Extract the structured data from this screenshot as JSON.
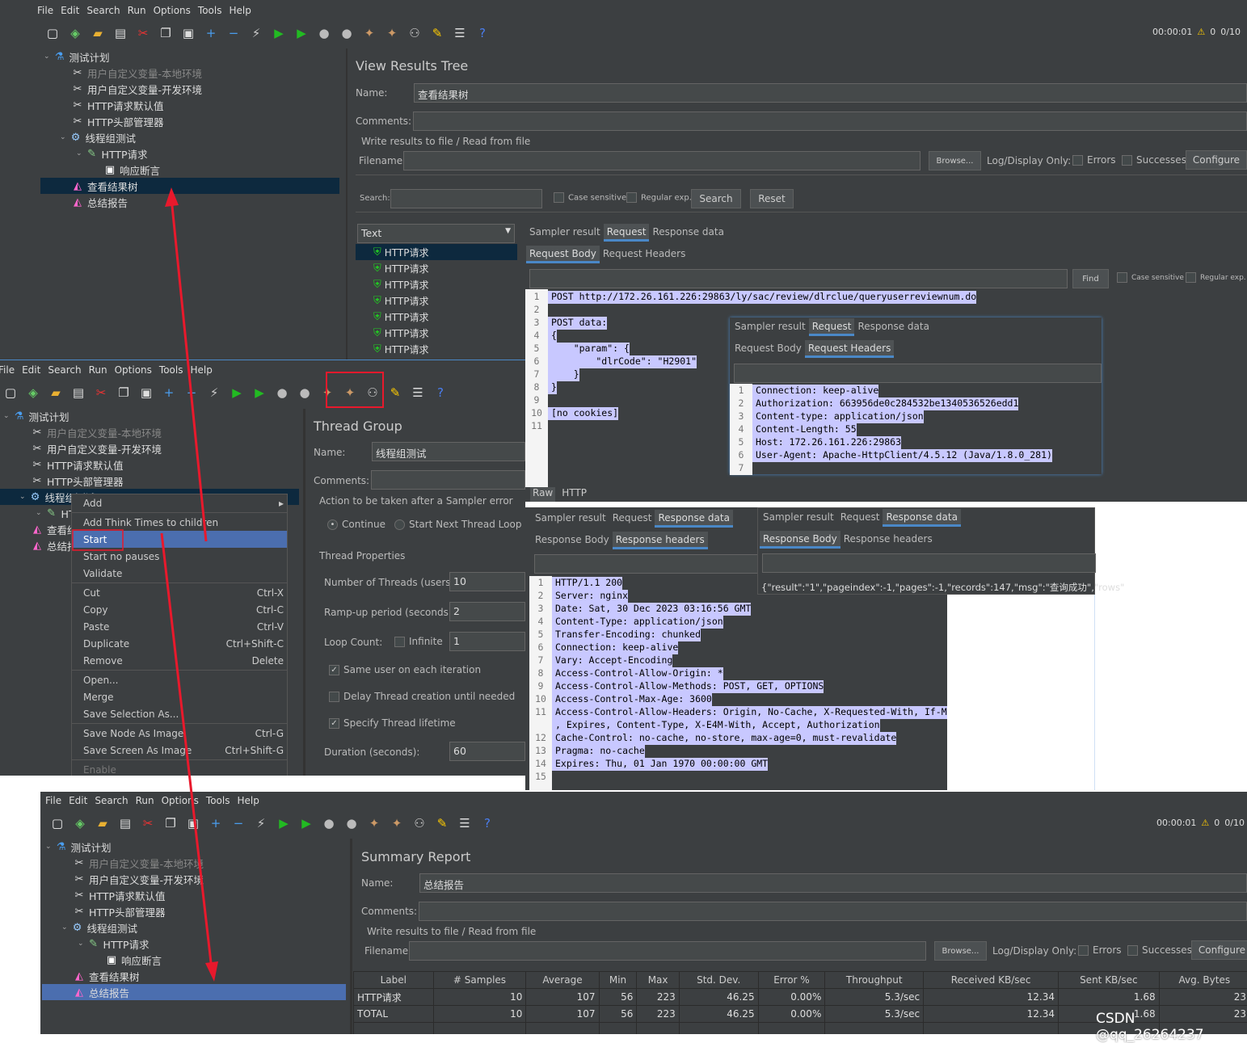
{
  "menu": [
    "File",
    "Edit",
    "Search",
    "Run",
    "Options",
    "Tools",
    "Help"
  ],
  "toolbar_icons": [
    [
      "new-icon",
      "▢",
      "#eee"
    ],
    [
      "templates-icon",
      "◈",
      "#6c6"
    ],
    [
      "open-icon",
      "▰",
      "#e9b032"
    ],
    [
      "save-icon",
      "▤",
      "#ddd"
    ],
    [
      "cut-icon",
      "✂",
      "#e33"
    ],
    [
      "copy-icon",
      "❐",
      "#ddd"
    ],
    [
      "paste-icon",
      "▣",
      "#ddd"
    ],
    [
      "expand-icon",
      "+",
      "#4a9ef0"
    ],
    [
      "collapse-icon",
      "−",
      "#4a9ef0"
    ],
    [
      "toggle-icon",
      "⚡",
      "#ccc"
    ],
    [
      "start-icon",
      "▶",
      "#2b2"
    ],
    [
      "start-no-pauses-icon",
      "▶",
      "#2b2"
    ],
    [
      "stop-icon",
      "●",
      "#bbb"
    ],
    [
      "shutdown-icon",
      "●",
      "#bbb"
    ],
    [
      "clear-icon",
      "✦",
      "#c96"
    ],
    [
      "clear-all-icon",
      "✦",
      "#c96"
    ],
    [
      "search-icon",
      "⚇",
      "#ccc"
    ],
    [
      "reset-search-icon",
      "✎",
      "#fc0"
    ],
    [
      "function-helper-icon",
      "☰",
      "#ddd"
    ],
    [
      "help-icon",
      "?",
      "#4a7ef0"
    ]
  ],
  "win1": {
    "timer": "00:00:01",
    "warn": "0",
    "threads": "0/10",
    "tree": [
      [
        "plan",
        "测试计划",
        "flask",
        0,
        ""
      ],
      [
        "var-local",
        "用户自定义变量-本地环境",
        "tool",
        1,
        "dim"
      ],
      [
        "var-dev",
        "用户自定义变量-开发环境",
        "tool",
        1,
        ""
      ],
      [
        "http-default",
        "HTTP请求默认值",
        "tool",
        1,
        ""
      ],
      [
        "header-mgr",
        "HTTP头部管理器",
        "tool",
        1,
        ""
      ],
      [
        "thread-group",
        "线程组测试",
        "gear",
        1,
        ""
      ],
      [
        "http-request",
        "HTTP请求",
        "pipette",
        2,
        ""
      ],
      [
        "assertion",
        "响应断言",
        "assert",
        3,
        ""
      ],
      [
        "results-tree",
        "查看结果树",
        "chart",
        1,
        "sel"
      ],
      [
        "summary",
        "总结报告",
        "chart",
        1,
        ""
      ]
    ],
    "title": "View Results Tree",
    "name_label": "Name:",
    "name_value": "查看结果树",
    "comments_label": "Comments:",
    "write_label": "Write results to file / Read from file",
    "filename_label": "Filename",
    "browse": "Browse...",
    "log_only": "Log/Display Only:",
    "errors": "Errors",
    "successes": "Successes",
    "configure": "Configure",
    "search_label": "Search:",
    "case": "Case sensitive",
    "regex": "Regular exp.",
    "search_btn": "Search",
    "reset_btn": "Reset",
    "renderer": "Text",
    "samples": [
      "HTTP请求",
      "HTTP请求",
      "HTTP请求",
      "HTTP请求",
      "HTTP请求",
      "HTTP请求",
      "HTTP请求"
    ],
    "tabs": [
      "Sampler result",
      "Request",
      "Response data"
    ],
    "subtabs": [
      "Request Body",
      "Request Headers"
    ],
    "find": "Find",
    "body_lines": [
      "POST http://172.26.161.226:29863/ly/sac/review/dlrclue/queryuserreviewnum.do",
      "",
      "POST data:",
      "{",
      "    \"param\": {",
      "        \"dlrCode\": \"H2901\"",
      "    }",
      "}",
      "",
      "[no cookies]",
      ""
    ],
    "raw_tabs": [
      "Raw",
      "HTTP"
    ]
  },
  "req_headers": {
    "tabs": [
      "Sampler result",
      "Request",
      "Response data"
    ],
    "subtabs": [
      "Request Body",
      "Request Headers"
    ],
    "lines": [
      "Connection: keep-alive",
      "Authorization: 663956de0c284532be1340536526edd1",
      "Content-type: application/json",
      "Content-Length: 55",
      "Host: 172.26.161.226:29863",
      "User-Agent: Apache-HttpClient/4.5.12 (Java/1.8.0_281)",
      ""
    ]
  },
  "resp_headers": {
    "tabs": [
      "Sampler result",
      "Request",
      "Response data"
    ],
    "subtabs": [
      "Response Body",
      "Response headers"
    ],
    "lines": [
      "HTTP/1.1 200",
      "Server: nginx",
      "Date: Sat, 30 Dec 2023 03:16:56 GMT",
      "Content-Type: application/json",
      "Transfer-Encoding: chunked",
      "Connection: keep-alive",
      "Vary: Accept-Encoding",
      "Access-Control-Allow-Origin: *",
      "Access-Control-Allow-Methods: POST, GET, OPTIONS",
      "Access-Control-Max-Age: 3600",
      "Access-Control-Allow-Headers: Origin, No-Cache, X-Requested-With, If-M",
      ", Expires, Content-Type, X-E4M-With, Accept, Authorization",
      "Cache-Control: no-cache, no-store, max-age=0, must-revalidate",
      "Pragma: no-cache",
      "Expires: Thu, 01 Jan 1970 00:00:00 GMT",
      ""
    ],
    "numbers": [
      "1",
      "2",
      "3",
      "4",
      "5",
      "6",
      "7",
      "8",
      "9",
      "10",
      "11",
      "",
      "12",
      "13",
      "14",
      "15"
    ]
  },
  "resp_body": {
    "tabs": [
      "Sampler result",
      "Request",
      "Response data"
    ],
    "subtabs": [
      "Response Body",
      "Response headers"
    ],
    "text": "{\"result\":\"1\",\"pageindex\":-1,\"pages\":-1,\"records\":147,\"msg\":\"查询成功\",\"rows\""
  },
  "win2": {
    "tree": [
      [
        "plan",
        "测试计划",
        "flask",
        0,
        ""
      ],
      [
        "var-local",
        "用户自定义变量-本地环境",
        "tool",
        1,
        "dim"
      ],
      [
        "var-dev",
        "用户自定义变量-开发环境",
        "tool",
        1,
        ""
      ],
      [
        "http-default",
        "HTTP请求默认值",
        "tool",
        1,
        ""
      ],
      [
        "header-mgr",
        "HTTP头部管理器",
        "tool",
        1,
        ""
      ],
      [
        "thread-group",
        "线程组测试",
        "gear",
        1,
        "sel"
      ],
      [
        "http-request",
        "HTTP请求",
        "pipette",
        2,
        ""
      ],
      [
        "results-tree",
        "查看结果树",
        "chart",
        1,
        ""
      ],
      [
        "summary",
        "总结报告",
        "chart",
        1,
        ""
      ]
    ],
    "title": "Thread Group",
    "name_label": "Name:",
    "name_value": "线程组测试",
    "comments_label": "Comments:",
    "action_label": "Action to be taken after a Sampler error",
    "continue": "Continue",
    "next_loop": "Start Next Thread Loop",
    "props_label": "Thread Properties",
    "threads_label": "Number of Threads (users):",
    "threads": "10",
    "ramp_label": "Ramp-up period (seconds):",
    "ramp": "2",
    "loop_label": "Loop Count:",
    "infinite": "Infinite",
    "loop": "1",
    "same_user": "Same user on each iteration",
    "delay": "Delay Thread creation until needed",
    "lifetime": "Specify Thread lifetime",
    "duration_label": "Duration (seconds):",
    "duration": "60"
  },
  "context_menu": [
    [
      "Add",
      "▸",
      ""
    ],
    [
      "sep"
    ],
    [
      "Add Think Times to children",
      "",
      ""
    ],
    [
      "Start",
      "",
      "on"
    ],
    [
      "Start no pauses",
      "",
      ""
    ],
    [
      "Validate",
      "",
      ""
    ],
    [
      "sep"
    ],
    [
      "Cut",
      "Ctrl-X",
      ""
    ],
    [
      "Copy",
      "Ctrl-C",
      ""
    ],
    [
      "Paste",
      "Ctrl-V",
      ""
    ],
    [
      "Duplicate",
      "Ctrl+Shift-C",
      ""
    ],
    [
      "Remove",
      "Delete",
      ""
    ],
    [
      "sep"
    ],
    [
      "Open...",
      "",
      ""
    ],
    [
      "Merge",
      "",
      ""
    ],
    [
      "Save Selection As...",
      "",
      ""
    ],
    [
      "sep"
    ],
    [
      "Save Node As Image",
      "Ctrl-G",
      ""
    ],
    [
      "Save Screen As Image",
      "Ctrl+Shift-G",
      ""
    ],
    [
      "sep"
    ],
    [
      "Enable",
      "",
      "dis"
    ]
  ],
  "win3": {
    "timer": "00:00:01",
    "warn": "0",
    "threads": "0/10",
    "tree": [
      [
        "plan",
        "测试计划",
        "flask",
        0,
        ""
      ],
      [
        "var-local",
        "用户自定义变量-本地环境",
        "tool",
        1,
        "dim"
      ],
      [
        "var-dev",
        "用户自定义变量-开发环境",
        "tool",
        1,
        ""
      ],
      [
        "http-default",
        "HTTP请求默认值",
        "tool",
        1,
        ""
      ],
      [
        "header-mgr",
        "HTTP头部管理器",
        "tool",
        1,
        ""
      ],
      [
        "thread-group",
        "线程组测试",
        "gear",
        1,
        ""
      ],
      [
        "http-request",
        "HTTP请求",
        "pipette",
        2,
        ""
      ],
      [
        "assertion",
        "响应断言",
        "assert",
        3,
        ""
      ],
      [
        "results-tree",
        "查看结果树",
        "chart",
        1,
        ""
      ],
      [
        "summary",
        "总结报告",
        "chart",
        1,
        "sel2"
      ]
    ],
    "title": "Summary Report",
    "name_label": "Name:",
    "name_value": "总结报告",
    "comments_label": "Comments:",
    "write_label": "Write results to file / Read from file",
    "filename_label": "Filename",
    "browse": "Browse...",
    "log_only": "Log/Display Only:",
    "errors": "Errors",
    "successes": "Successes",
    "configure": "Configure",
    "columns": [
      "Label",
      "# Samples",
      "Average",
      "Min",
      "Max",
      "Std. Dev.",
      "Error %",
      "Throughput",
      "Received KB/sec",
      "Sent KB/sec",
      "Avg. Bytes"
    ],
    "rows": [
      [
        "HTTP请求",
        "10",
        "107",
        "56",
        "223",
        "46.25",
        "0.00%",
        "5.3/sec",
        "12.34",
        "1.68",
        "23"
      ],
      [
        "TOTAL",
        "10",
        "107",
        "56",
        "223",
        "46.25",
        "0.00%",
        "5.3/sec",
        "12.34",
        "1.68",
        "23"
      ]
    ]
  },
  "watermark": "CSDN @qq_26264237",
  "colors": {
    "bg": "#3c3f41",
    "selection": "#c8c8ff",
    "accent": "#4a88c7",
    "annotation": "#e8192c"
  }
}
